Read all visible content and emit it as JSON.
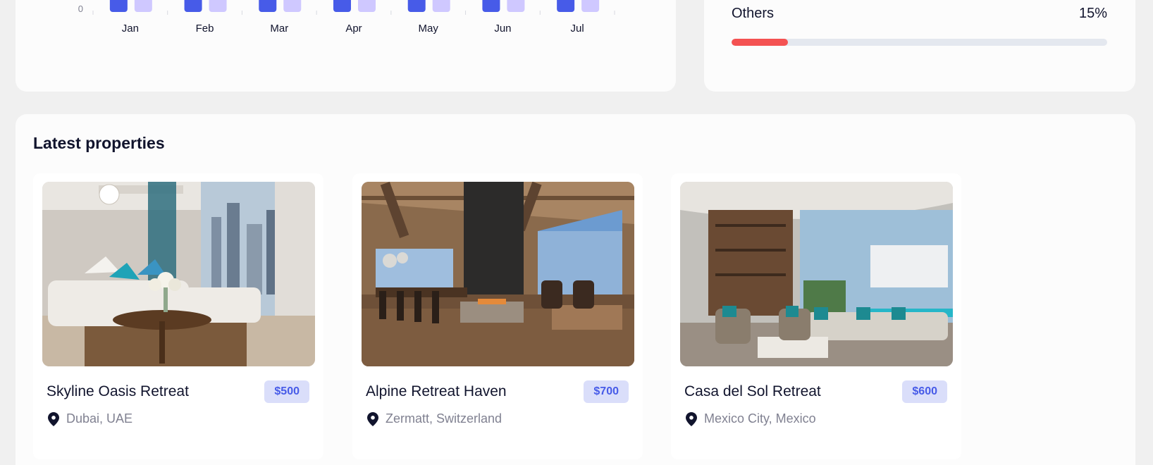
{
  "chart_data": {
    "type": "bar",
    "categories": [
      "Jan",
      "Feb",
      "Mar",
      "Apr",
      "May",
      "Jun",
      "Jul"
    ],
    "y_tick_visible": "0",
    "series": [
      {
        "color": "#475be8"
      },
      {
        "color": "#cfc8ff"
      }
    ]
  },
  "breakdown": {
    "label": "Others",
    "value_text": "15%",
    "fraction": 0.15,
    "fill_color": "#f45252"
  },
  "latest": {
    "title": "Latest properties",
    "items": [
      {
        "name": "Skyline Oasis Retreat",
        "price": "$500",
        "location": "Dubai, UAE",
        "icon": "location-pin-icon"
      },
      {
        "name": "Alpine Retreat Haven",
        "price": "$700",
        "location": "Zermatt, Switzerland",
        "icon": "location-pin-icon"
      },
      {
        "name": "Casa del Sol Retreat",
        "price": "$600",
        "location": "Mexico City, Mexico",
        "icon": "location-pin-icon"
      }
    ]
  },
  "colors": {
    "accent": "#475be8",
    "price_bg": "#dadefa",
    "danger": "#f45252",
    "muted_text": "#808191"
  }
}
